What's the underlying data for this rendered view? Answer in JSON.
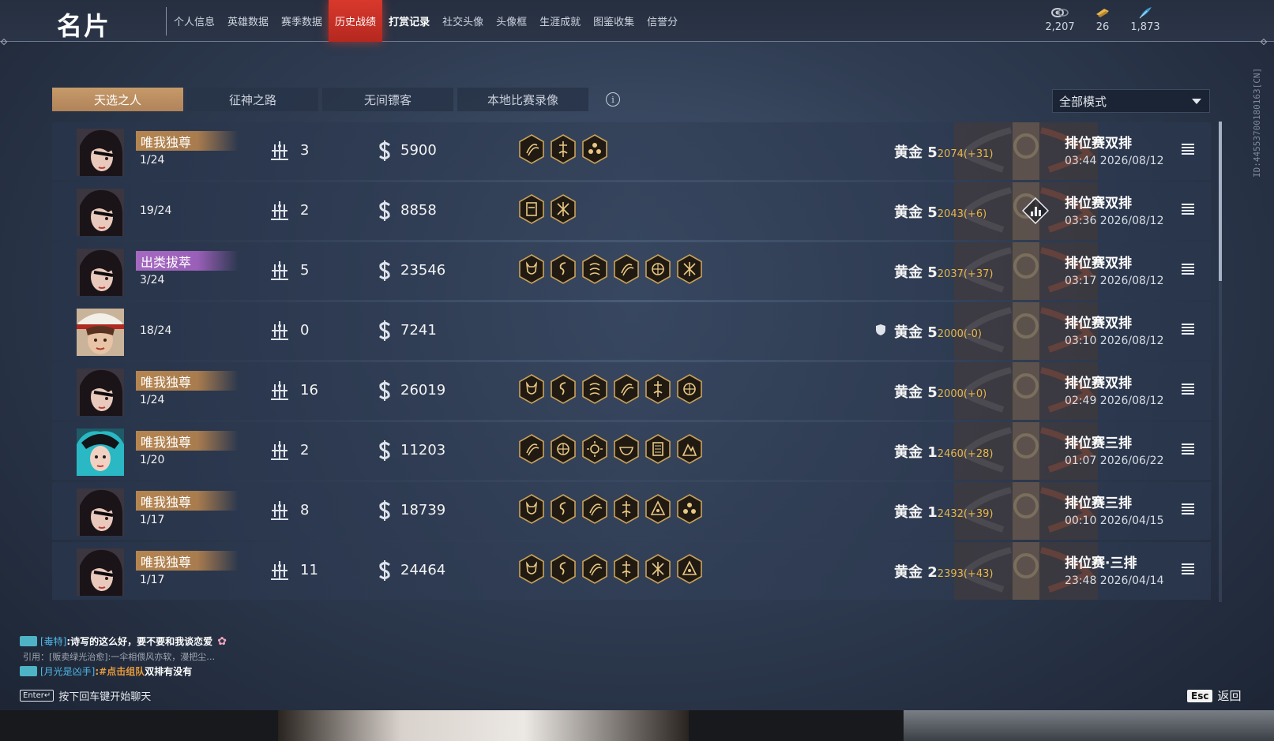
{
  "header": {
    "title": "名片",
    "nav": [
      "个人信息",
      "英雄数据",
      "赛季数据",
      "历史战绩",
      "打赏记录",
      "社交头像",
      "头像框",
      "生涯成就",
      "图鉴收集",
      "信誉分"
    ],
    "active_index": 3,
    "currencies": [
      {
        "icon": "eye-icon",
        "value": "2,207"
      },
      {
        "icon": "ticket-icon",
        "value": "26"
      },
      {
        "icon": "feather-icon",
        "value": "1,873"
      }
    ]
  },
  "side_id": "ID:445537001801​63[CN]",
  "tabs": [
    "天选之人",
    "征神之路",
    "无间镖客",
    "本地比赛录像"
  ],
  "active_tab": 0,
  "mode_filter": "全部模式",
  "matches": [
    {
      "avatar": "eyepatch",
      "title": "唯我独尊",
      "title_color": "gold",
      "placement": "1/24",
      "kills": "3",
      "damage": "5900",
      "traits": [
        "claw",
        "sword",
        "cluster"
      ],
      "shield": false,
      "rank": "黄金 5",
      "points": "2074(+31)",
      "chart": false,
      "mode": "排位赛双排",
      "time": "03:44  2026/08/12"
    },
    {
      "avatar": "eyepatch",
      "title": "",
      "title_color": "",
      "placement": "19/24",
      "kills": "2",
      "damage": "8858",
      "traits": [
        "mask",
        "star"
      ],
      "shield": false,
      "rank": "黄金 5",
      "points": "2043(+6)",
      "chart": true,
      "mode": "排位赛双排",
      "time": "03:36  2026/08/12"
    },
    {
      "avatar": "eyepatch",
      "title": "出类拔萃",
      "title_color": "purple",
      "placement": "3/24",
      "kills": "5",
      "damage": "23546",
      "traits": [
        "demon",
        "dragon",
        "wave",
        "claw",
        "lotus",
        "star"
      ],
      "shield": false,
      "rank": "黄金 5",
      "points": "2037(+37)",
      "chart": false,
      "mode": "排位赛双排",
      "time": "03:17  2026/08/12"
    },
    {
      "avatar": "hat",
      "title": "",
      "title_color": "",
      "placement": "18/24",
      "kills": "0",
      "damage": "7241",
      "traits": [],
      "shield": true,
      "rank": "黄金 5",
      "points": "2000(-0)",
      "chart": false,
      "mode": "排位赛双排",
      "time": "03:10  2026/08/12"
    },
    {
      "avatar": "eyepatch",
      "title": "唯我独尊",
      "title_color": "gold",
      "placement": "1/24",
      "kills": "16",
      "damage": "26019",
      "traits": [
        "demon",
        "dragon",
        "wave",
        "claw",
        "sword",
        "lotus"
      ],
      "shield": false,
      "rank": "黄金 5",
      "points": "2000(+0)",
      "chart": false,
      "mode": "排位赛双排",
      "time": "02:49  2026/08/12"
    },
    {
      "avatar": "teal",
      "title": "唯我独尊",
      "title_color": "gold",
      "placement": "1/20",
      "kills": "2",
      "damage": "11203",
      "traits": [
        "claw",
        "lotus",
        "sun",
        "bowl",
        "scroll",
        "mountain"
      ],
      "shield": false,
      "rank": "黄金 1",
      "points": "2460(+28)",
      "chart": false,
      "mode": "排位赛三排",
      "time": "01:07  2026/06/22"
    },
    {
      "avatar": "eyepatch",
      "title": "唯我独尊",
      "title_color": "gold",
      "placement": "1/17",
      "kills": "8",
      "damage": "18739",
      "traits": [
        "demon",
        "dragon",
        "claw",
        "sword",
        "pyramid",
        "cluster"
      ],
      "shield": false,
      "rank": "黄金 1",
      "points": "2432(+39)",
      "chart": false,
      "mode": "排位赛三排",
      "time": "00:10  2026/04/15"
    },
    {
      "avatar": "eyepatch",
      "title": "唯我独尊",
      "title_color": "gold",
      "placement": "1/17",
      "kills": "11",
      "damage": "24464",
      "traits": [
        "demon",
        "dragon",
        "claw",
        "sword",
        "star",
        "pyramid"
      ],
      "shield": false,
      "rank": "黄金 2",
      "points": "2393(+43)",
      "chart": false,
      "mode": "排位赛·三排",
      "time": "23:48  2026/04/14"
    }
  ],
  "chat": {
    "line1": {
      "name": "[毒特]",
      "message": ":诗写的这么好，要不要和我谈恋爱"
    },
    "line2": "引用：[贩卖绿光治愈]:一伞相偎风亦软，漫把尘…",
    "line3": {
      "name": "[月光是凶手]",
      "link": ":#点击组队",
      "message": " 双排有没有"
    },
    "enter_key": "Enter↵",
    "enter_hint": "按下回车键开始聊天"
  },
  "esc": {
    "key": "Esc",
    "label": "返回"
  }
}
